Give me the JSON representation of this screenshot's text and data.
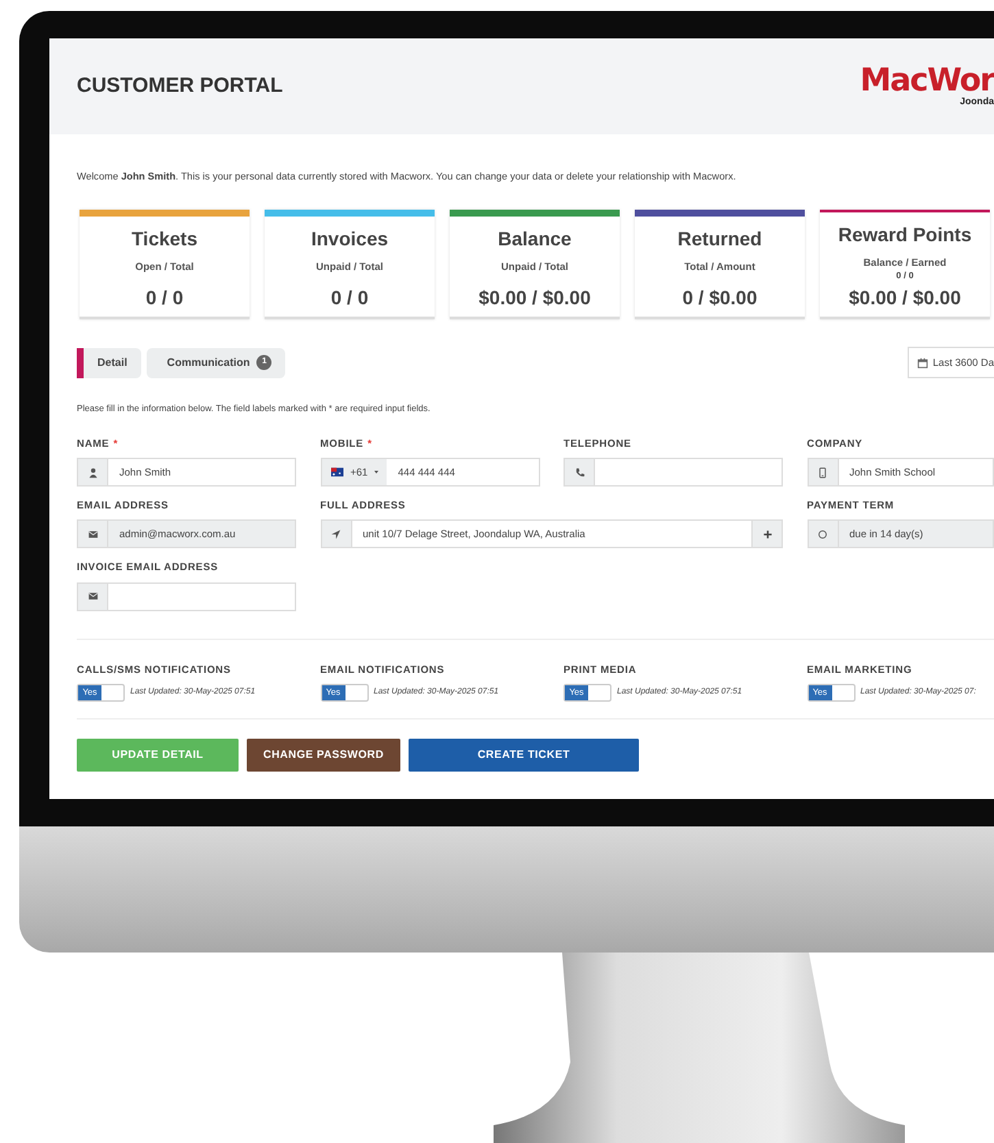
{
  "header": {
    "title": "CUSTOMER PORTAL",
    "logo": "MacWor",
    "logo_sub": "Joonda"
  },
  "welcome": "Welcome **John Smith**. This is your personal data currently stored with Macworx. You can change your data or delete your relationship with Macworx.",
  "stats": [
    {
      "title": "Tickets",
      "subtitle": "Open / Total",
      "value": "0 / 0",
      "color": "#e8a33d"
    },
    {
      "title": "Invoices",
      "subtitle": "Unpaid / Total",
      "value": "0 / 0",
      "color": "#45bde9"
    },
    {
      "title": "Balance",
      "subtitle": "Unpaid / Total",
      "value": "$0.00 / $0.00",
      "color": "#3a9a4f"
    },
    {
      "title": "Returned",
      "subtitle": "Total / Amount",
      "value": "0 / $0.00",
      "color": "#4f4f9e"
    },
    {
      "title": "Reward Points",
      "subtitle": "Balance / Earned",
      "note": "0 / 0",
      "value": "$0.00 / $0.00",
      "color": "#c2185b"
    }
  ],
  "tabs": [
    {
      "label": "Detail",
      "selected": true
    },
    {
      "label": "Communication",
      "badge": "1",
      "selected": false
    }
  ],
  "date_range": "Last 3600 Da",
  "hint": "Please fill in the information below. The field labels marked with * are required input fields.",
  "fields": [
    {
      "label": "NAME",
      "required_mark": "*",
      "kind": "user",
      "value": "John Smith",
      "readonly": false,
      "wide": false
    },
    {
      "label": "MOBILE",
      "required_mark": "*",
      "kind": "phone-country",
      "code": "+61",
      "value": "444 444 444",
      "readonly": false,
      "wide": false
    },
    {
      "label": "TELEPHONE",
      "kind": "phone",
      "readonly": false,
      "wide": false
    },
    {
      "label": "COMPANY",
      "kind": "building",
      "value": "John Smith School",
      "readonly": false,
      "wide": false
    },
    {
      "label": "EMAIL ADDRESS",
      "kind": "email",
      "value": "admin@macworx.com.au",
      "readonly": true,
      "wide": false
    },
    {
      "label": "FULL ADDRESS",
      "kind": "address",
      "value": "unit 10/7 Delage Street, Joondalup WA, Australia",
      "readonly": false,
      "wide": true
    },
    {
      "label": "PAYMENT TERM",
      "kind": "term",
      "value": "due in 14 day(s)",
      "readonly": true,
      "wide": false
    },
    {
      "label": "INVOICE EMAIL ADDRESS",
      "kind": "email",
      "readonly": false,
      "wide": false
    }
  ],
  "notifications": [
    {
      "label": "CALLS/SMS NOTIFICATIONS",
      "on": true,
      "toggle_text": "Yes",
      "updated": "Last Updated: 30-May-2025 07:51"
    },
    {
      "label": "EMAIL NOTIFICATIONS",
      "on": true,
      "toggle_text": "Yes",
      "updated": "Last Updated: 30-May-2025 07:51"
    },
    {
      "label": "PRINT MEDIA",
      "on": true,
      "toggle_text": "Yes",
      "updated": "Last Updated: 30-May-2025 07:51"
    },
    {
      "label": "EMAIL MARKETING",
      "on": true,
      "toggle_text": "Yes",
      "updated": "Last Updated: 30-May-2025 07:"
    }
  ],
  "buttons": [
    {
      "label": "UPDATE DETAIL",
      "kind": "success"
    },
    {
      "label": "CHANGE PASSWORD",
      "kind": "brown"
    },
    {
      "label": "CREATE TICKET",
      "kind": "primary"
    }
  ]
}
